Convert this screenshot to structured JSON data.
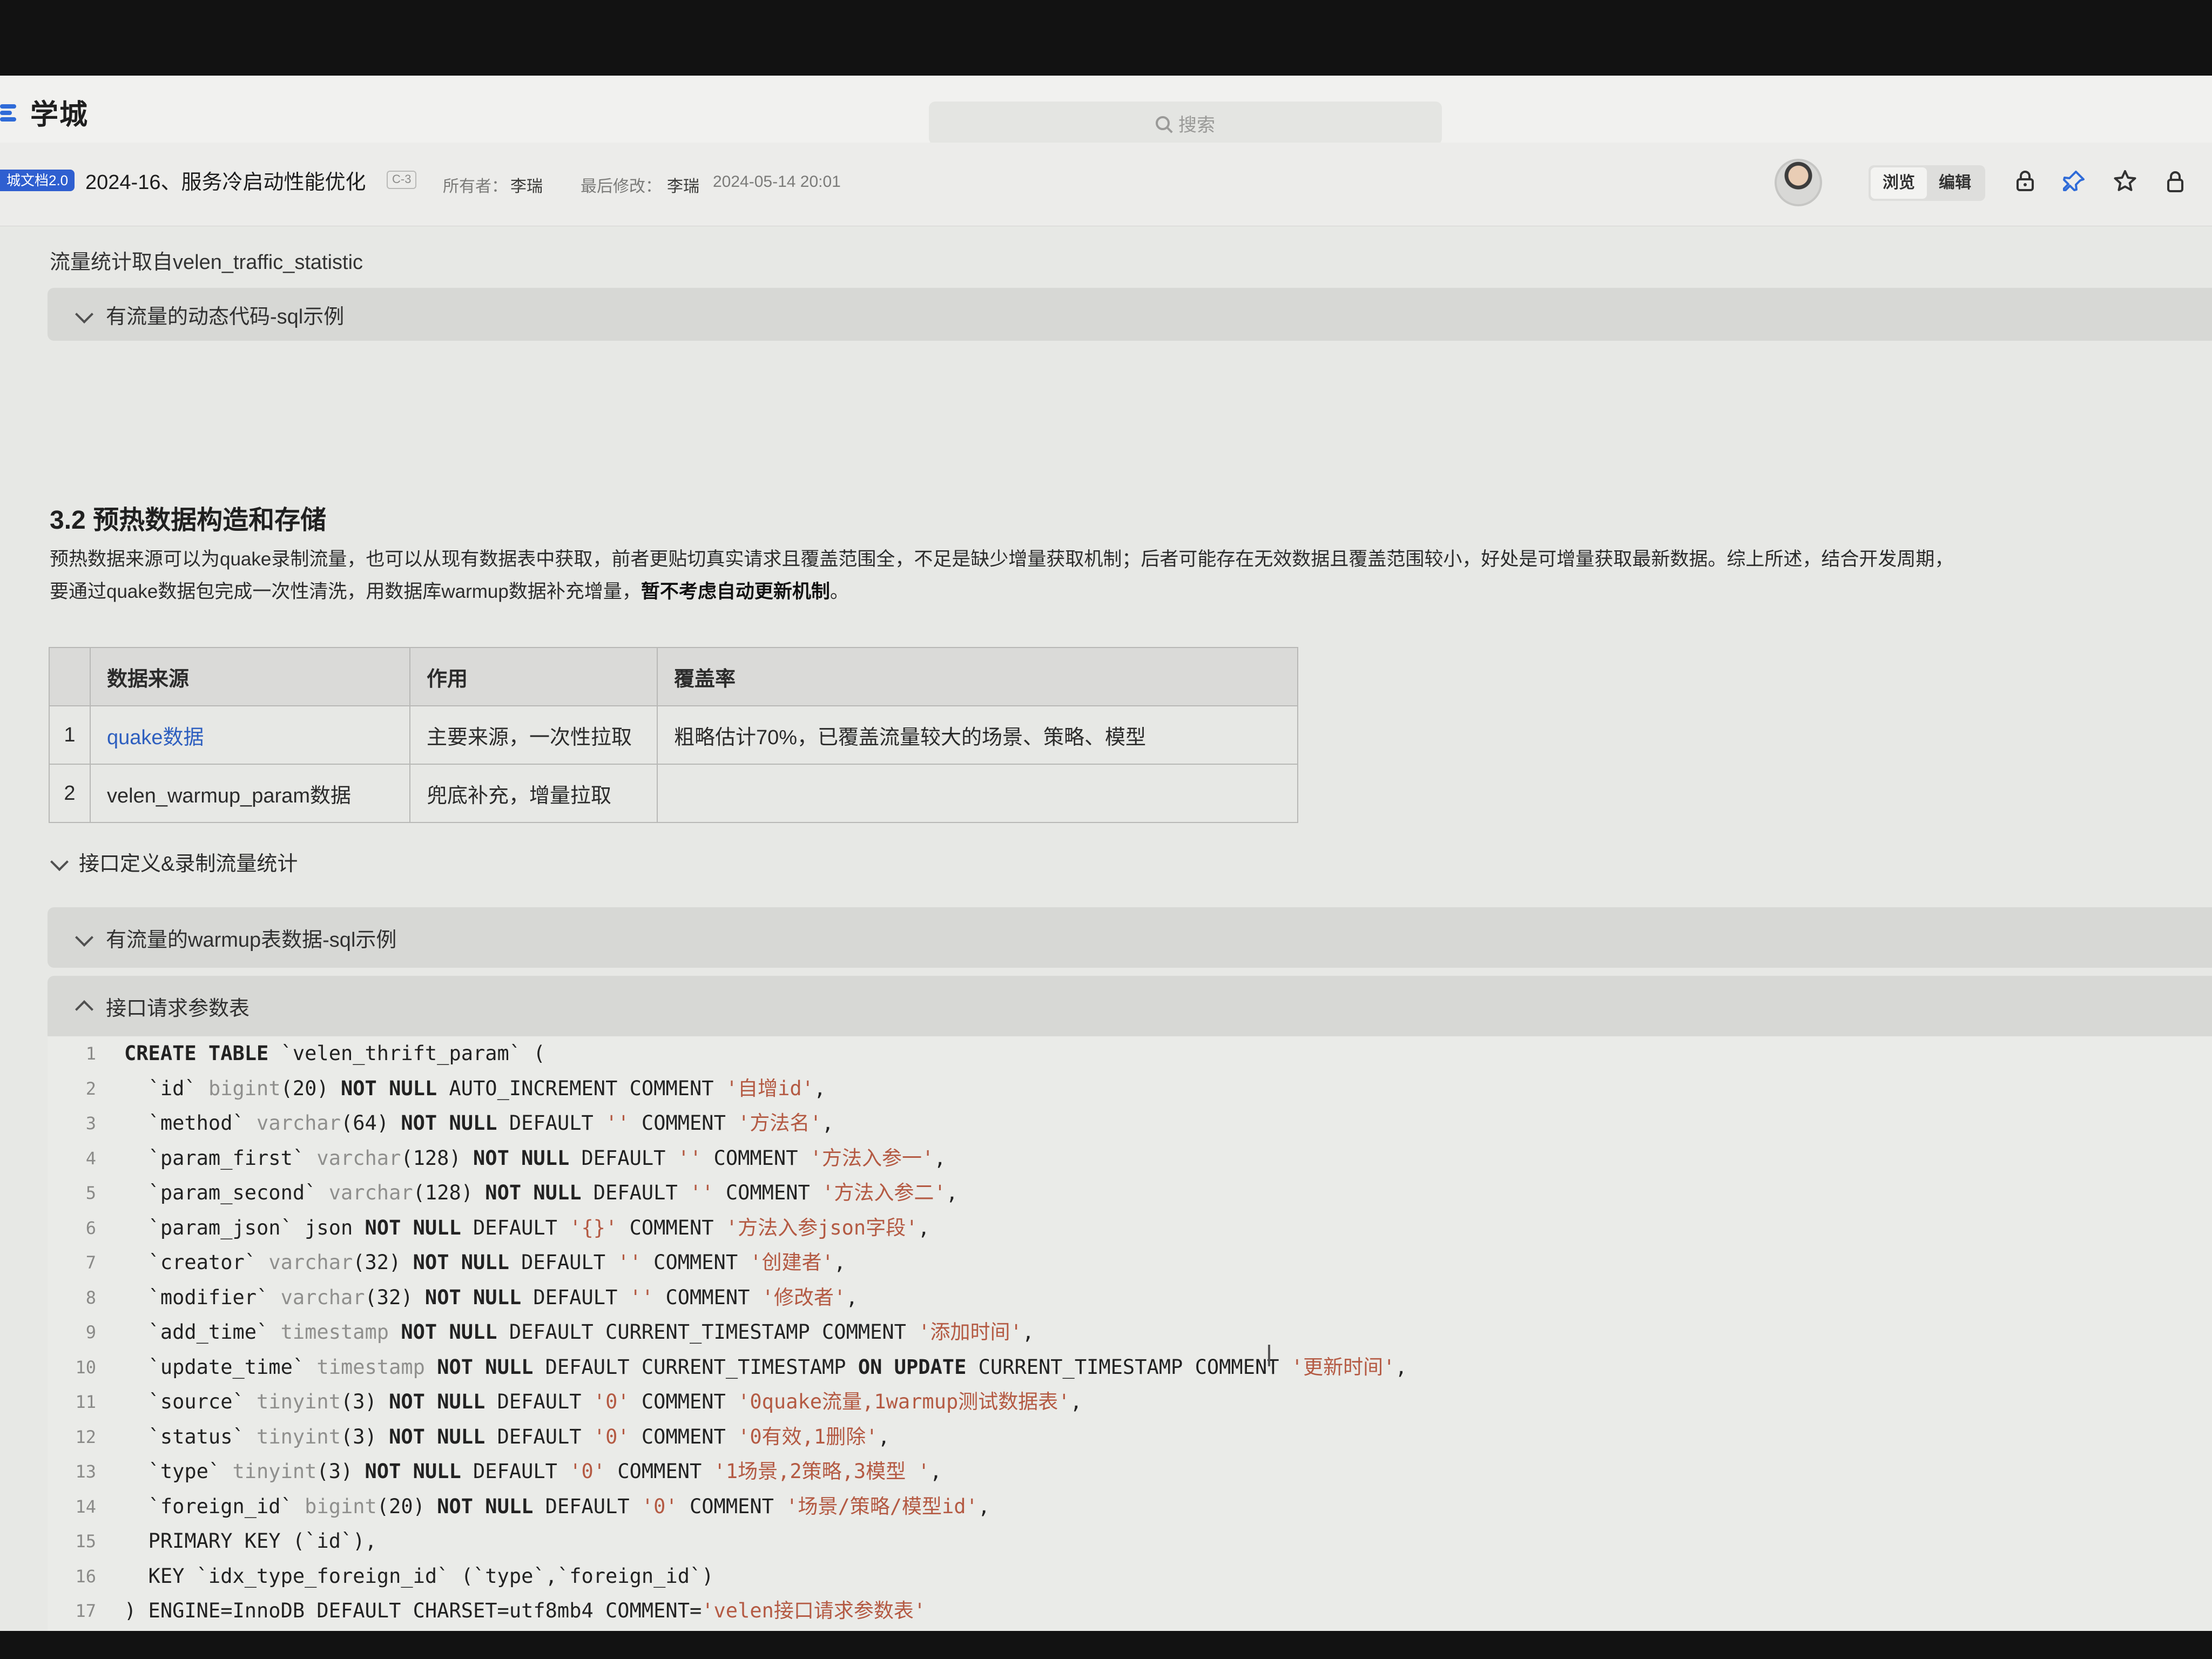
{
  "app": {
    "brand": "学城",
    "search_placeholder": "搜索"
  },
  "document": {
    "tag": "城文档2.0",
    "title": "2024-16、服务冷启动性能优化",
    "security_level": "C-3",
    "owner_label": "所有者：",
    "owner": "李瑞",
    "modified_label": "最后修改：",
    "modified_by": "李瑞",
    "modified_time": "2024-05-14 20:01",
    "mode_view": "浏览",
    "mode_edit": "编辑"
  },
  "content": {
    "traffic_source": "流量统计取自velen_traffic_statistic",
    "collapse_sql_dynamic": "有流量的动态代码-sql示例",
    "section_heading": "3.2 预热数据构造和存储",
    "intro_line_1": "预热数据来源可以为quake录制流量，也可以从现有数据表中获取，前者更贴切真实请求且覆盖范围全，不足是缺少增量获取机制；后者可能存在无效数据且覆盖范围较小，好处是可增量获取最新数据。综上所述，结合开发周期，",
    "intro_line_2_prefix": "要通过quake数据包完成一次性清洗，用数据库warmup数据补充增量，",
    "intro_line_2_bold": "暂不考虑自动更新机制",
    "intro_line_2_suffix": "。",
    "table": {
      "headers": [
        "",
        "数据来源",
        "作用",
        "覆盖率"
      ],
      "rows": [
        [
          "1",
          "quake数据",
          "主要来源，一次性拉取",
          "粗略估计70%，已覆盖流量较大的场景、策略、模型"
        ],
        [
          "2",
          "velen_warmup_param数据",
          "兜底补充，增量拉取",
          ""
        ]
      ]
    },
    "toggle_interface": "接口定义&录制流量统计",
    "collapse_warmup_sql": "有流量的warmup表数据-sql示例",
    "code_title": "接口请求参数表",
    "code_lines": [
      "CREATE TABLE `velen_thrift_param` (",
      "  `id` bigint(20) NOT NULL AUTO_INCREMENT COMMENT '自增id',",
      "  `method` varchar(64) NOT NULL DEFAULT '' COMMENT '方法名',",
      "  `param_first` varchar(128) NOT NULL DEFAULT '' COMMENT '方法入参一',",
      "  `param_second` varchar(128) NOT NULL DEFAULT '' COMMENT '方法入参二',",
      "  `param_json` json NOT NULL DEFAULT '{}' COMMENT '方法入参json字段',",
      "  `creator` varchar(32) NOT NULL DEFAULT '' COMMENT '创建者',",
      "  `modifier` varchar(32) NOT NULL DEFAULT '' COMMENT '修改者',",
      "  `add_time` timestamp NOT NULL DEFAULT CURRENT_TIMESTAMP COMMENT '添加时间',",
      "  `update_time` timestamp NOT NULL DEFAULT CURRENT_TIMESTAMP ON UPDATE CURRENT_TIMESTAMP COMMENT '更新时间',",
      "  `source` tinyint(3) NOT NULL DEFAULT '0' COMMENT '0quake流量,1warmup测试数据表',",
      "  `status` tinyint(3) NOT NULL DEFAULT '0' COMMENT '0有效,1删除',",
      "  `type` tinyint(3) NOT NULL DEFAULT '0' COMMENT '1场景,2策略,3模型 ',",
      "  `foreign_id` bigint(20) NOT NULL DEFAULT '0' COMMENT '场景/策略/模型id',",
      "  PRIMARY KEY (`id`),",
      "  KEY `idx_type_foreign_id` (`type`,`foreign_id`)",
      ") ENGINE=InnoDB DEFAULT CHARSET=utf8mb4 COMMENT='velen接口请求参数表'"
    ]
  },
  "colors": {
    "accent": "#2f6bd8",
    "link": "#2e5fbf",
    "string": "#b45a43",
    "keyword": "#2a2a28",
    "type": "#8f8f8d"
  }
}
